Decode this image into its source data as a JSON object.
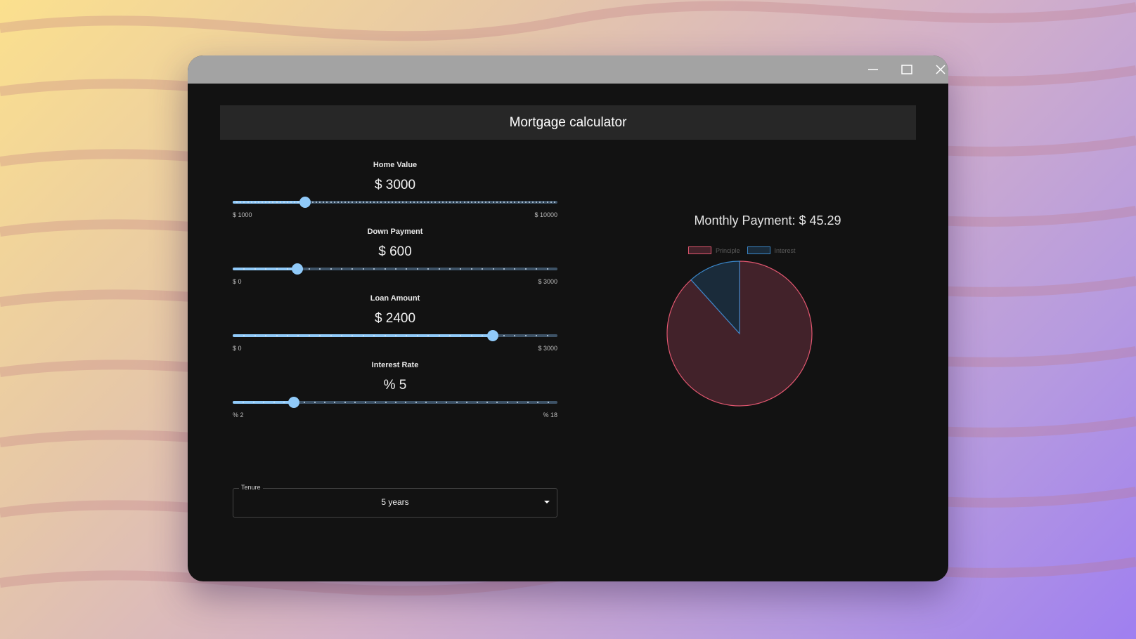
{
  "window": {
    "controls": [
      "minimize",
      "maximize",
      "close"
    ]
  },
  "header": {
    "title": "Mortgage calculator"
  },
  "sliders": [
    {
      "label": "Home Value",
      "value_text": "$ 3000",
      "min_text": "$ 1000",
      "max_text": "$ 10000",
      "min": 1000,
      "max": 10000,
      "value": 3000,
      "step": 100
    },
    {
      "label": "Down Payment",
      "value_text": "$ 600",
      "min_text": "$ 0",
      "max_text": "$ 3000",
      "min": 0,
      "max": 3000,
      "value": 600,
      "step": 100
    },
    {
      "label": "Loan Amount",
      "value_text": "$ 2400",
      "min_text": "$ 0",
      "max_text": "$ 3000",
      "min": 0,
      "max": 3000,
      "value": 2400,
      "step": 100
    },
    {
      "label": "Interest Rate",
      "value_text": "% 5",
      "min_text": "% 2",
      "max_text": "% 18",
      "min": 2,
      "max": 18,
      "value": 5,
      "step": 0.5
    }
  ],
  "tenure": {
    "label": "Tenure",
    "value": "5 years"
  },
  "result": {
    "monthly_payment_text": "Monthly Payment: $ 45.29"
  },
  "chart_data": {
    "type": "pie",
    "categories": [
      "Principle",
      "Interest"
    ],
    "values": [
      2400,
      317.4
    ],
    "colors": {
      "Principle": {
        "fill": "#42222a",
        "border": "#e0566f"
      },
      "Interest": {
        "fill": "#1a2b3a",
        "border": "#3a86c8"
      }
    },
    "legend": "top"
  },
  "colors": {
    "accent": "#90caf9",
    "background": "#121212",
    "titlebar": "#a3a3a3"
  }
}
